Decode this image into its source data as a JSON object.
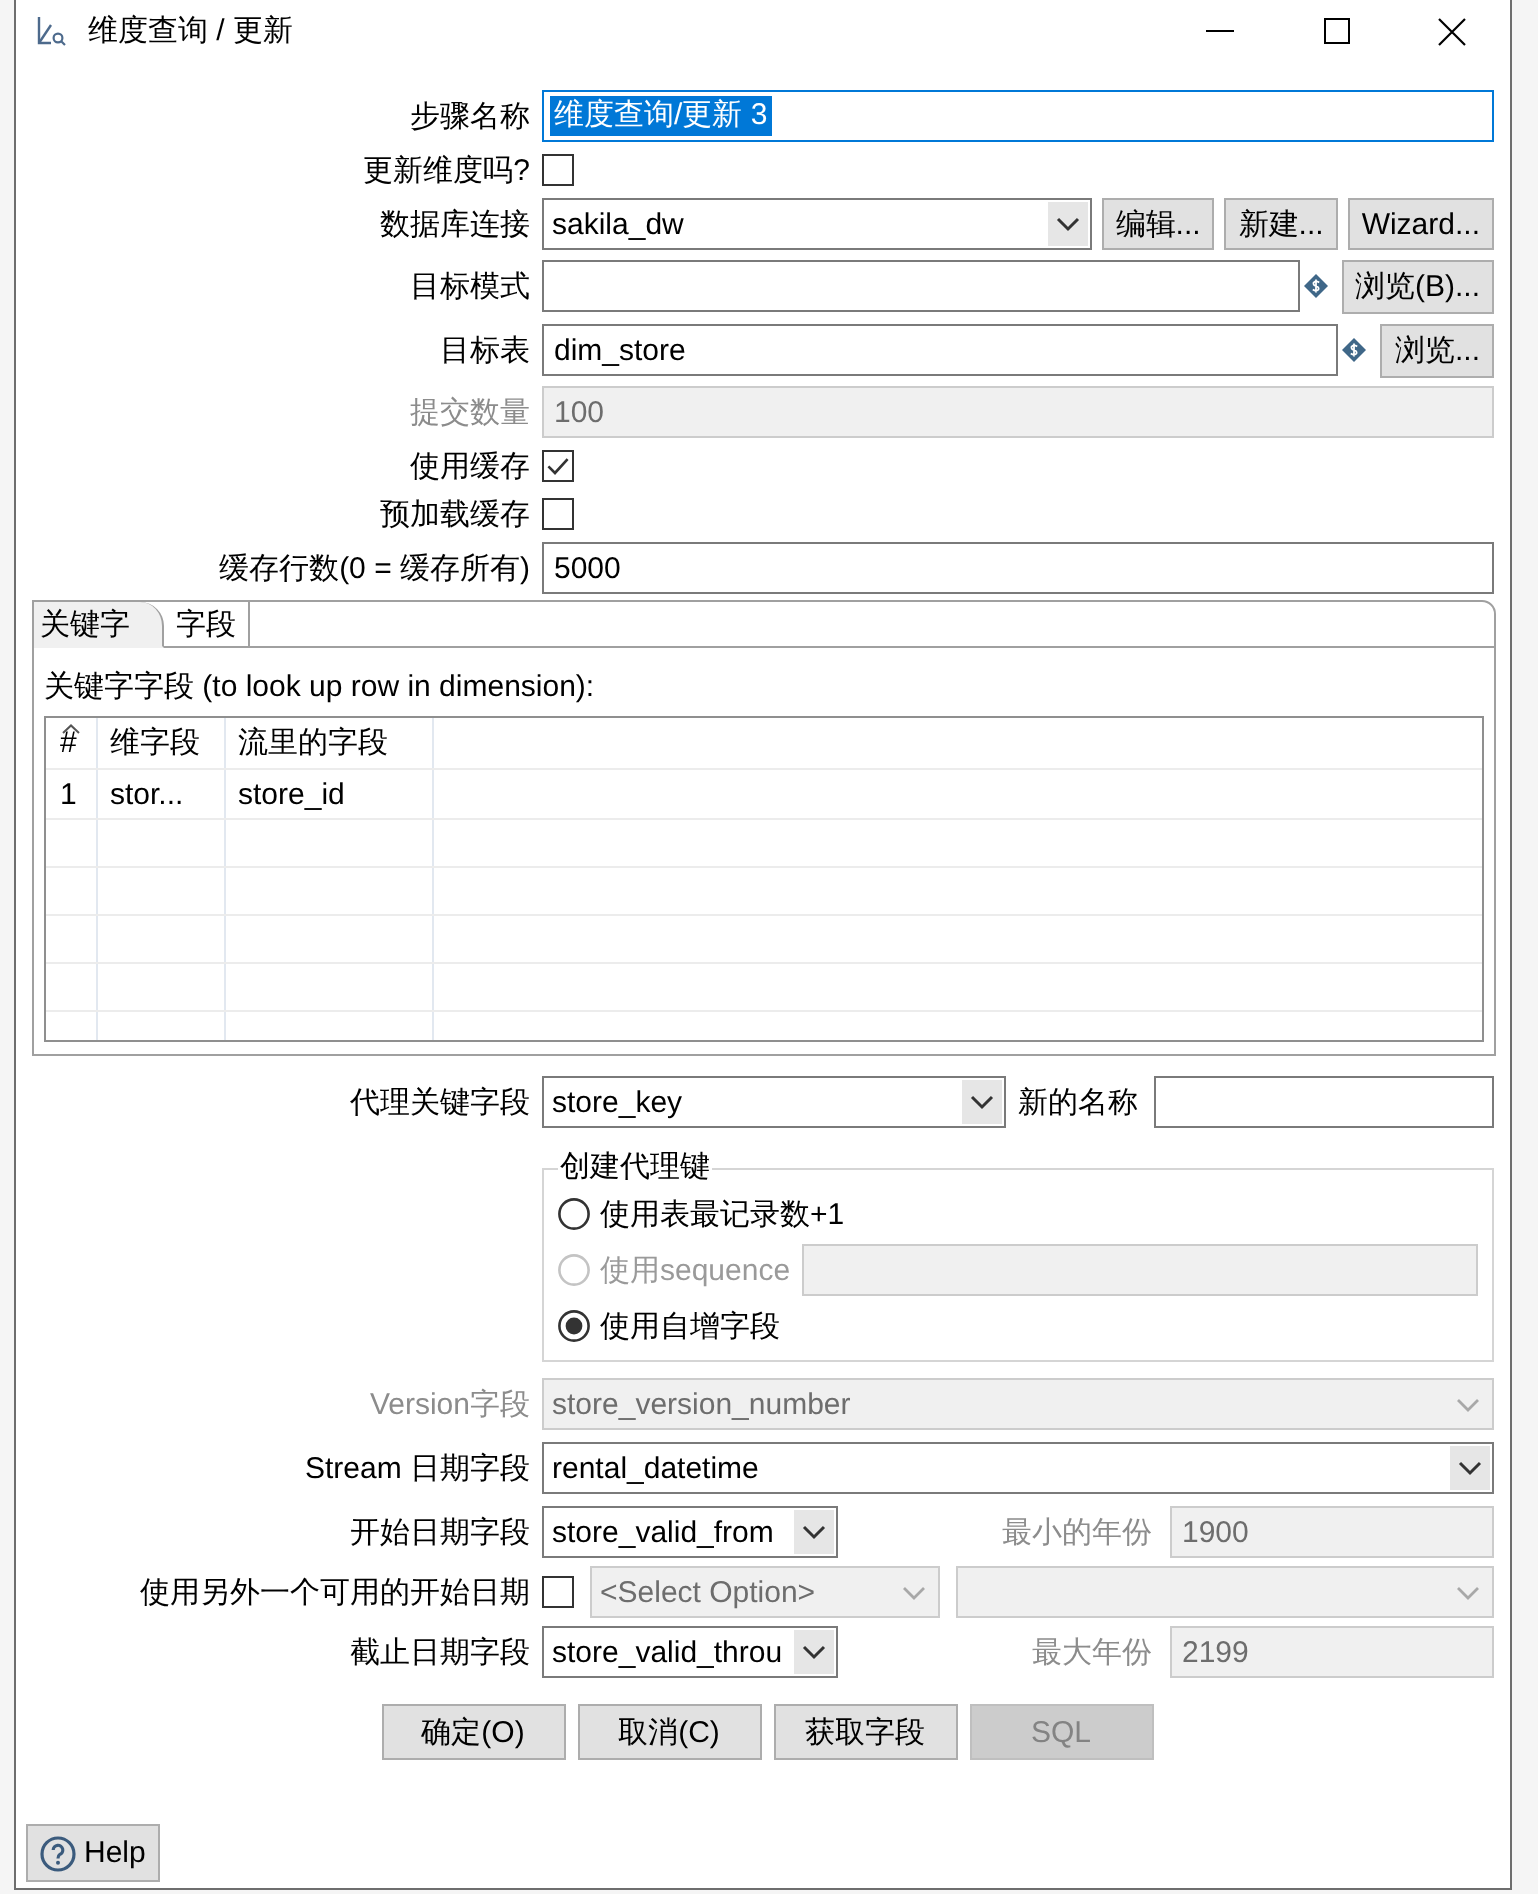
{
  "window": {
    "title": "维度查询 / 更新"
  },
  "form": [
    {
      "kind": "text",
      "label": "步骤名称",
      "value": "维度查询/更新 3",
      "focused": true,
      "disabled": false
    },
    {
      "kind": "checkbox",
      "label": "更新维度吗?",
      "checked": false
    },
    {
      "kind": "select",
      "label": "数据库连接",
      "value": "sakila_dw",
      "disabled": false,
      "buttons": [
        "编辑...",
        "新建...",
        "Wizard..."
      ]
    },
    {
      "kind": "text",
      "label": "目标模式",
      "focused": false,
      "disabled": false,
      "variable_icon": true,
      "buttons": [
        "浏览(B)..."
      ]
    },
    {
      "kind": "text",
      "label": "目标表",
      "value": "dim_store",
      "focused": false,
      "disabled": false,
      "variable_icon": true,
      "buttons": [
        "浏览..."
      ]
    },
    {
      "kind": "text",
      "label": "提交数量",
      "value": "100",
      "focused": false,
      "disabled": true
    },
    {
      "kind": "checkbox",
      "label": "使用缓存",
      "checked": true
    },
    {
      "kind": "checkbox",
      "label": "预加载缓存",
      "checked": false
    },
    {
      "kind": "text",
      "label": "缓存行数(0 = 缓存所有)",
      "value": "5000",
      "focused": false,
      "disabled": false
    }
  ],
  "tabs": [
    {
      "label": "关键字",
      "selected": true
    },
    {
      "label": "字段",
      "selected": false
    }
  ],
  "key_fields": {
    "caption": "关键字字段 (to look up row in dimension):",
    "columns": [
      "#",
      "维字段",
      "流里的字段"
    ],
    "rows": [
      [
        "1",
        "stor...",
        "store_id"
      ]
    ]
  },
  "surrogate": {
    "label": "代理关键字段",
    "value": "store_key",
    "new_name_label": "新的名称",
    "group_title": "创建代理键",
    "options": [
      {
        "kind": "plain",
        "label": "使用表最记录数+1",
        "selected": false,
        "disabled": false
      },
      {
        "kind": "with-field",
        "label": "使用sequence",
        "selected": false,
        "disabled": true
      },
      {
        "kind": "plain",
        "label": "使用自增字段",
        "selected": true,
        "disabled": false
      }
    ]
  },
  "date_form": [
    {
      "kind": "select",
      "label": "Version字段",
      "value": "store_version_number",
      "disabled": true
    },
    {
      "kind": "select",
      "label": "Stream 日期字段",
      "value": "rental_datetime",
      "disabled": false
    },
    {
      "kind": "year",
      "label": "开始日期字段",
      "value": "store_valid_from",
      "year_label": "最小的年份",
      "year": "1900",
      "year_disabled": true
    },
    {
      "kind": "alternative",
      "label": "使用另外一个可用的开始日期",
      "checked": false,
      "option": "<Select Option>",
      "disabled": true
    },
    {
      "kind": "year",
      "label": "截止日期字段",
      "value": "store_valid_throu",
      "year_label": "最大年份",
      "year": "2199",
      "year_disabled": true
    }
  ],
  "buttons": [
    {
      "label": "确定(O)",
      "disabled": false
    },
    {
      "label": "取消(C)",
      "disabled": false
    },
    {
      "label": "获取字段",
      "disabled": false
    },
    {
      "label": "SQL",
      "disabled": true
    }
  ],
  "help": {
    "label": "Help"
  }
}
